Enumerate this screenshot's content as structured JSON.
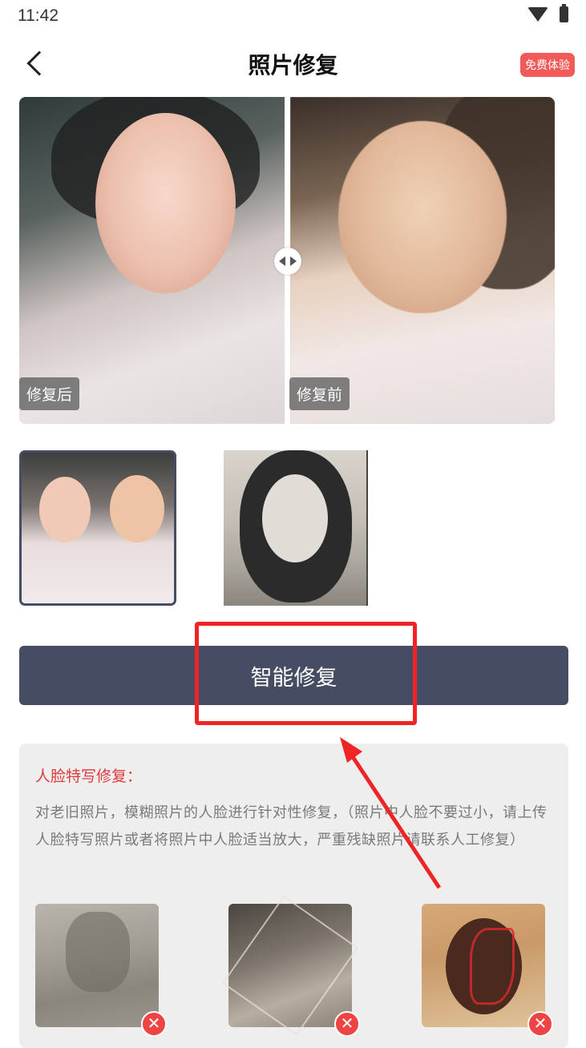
{
  "status": {
    "time": "11:42"
  },
  "header": {
    "title": "照片修复",
    "free_badge": "免费体验"
  },
  "compare": {
    "after_label": "修复后",
    "before_label": "修复前"
  },
  "main_button": {
    "label": "智能修复"
  },
  "info": {
    "heading": "人脸特写修复：",
    "description": "对老旧照片，模糊照片的人脸进行针对性修复，（照片中人脸不要过小，请上传人脸特写照片或者将照片中人脸适当放大，严重残缺照片请联系人工修复）"
  },
  "colors": {
    "primary": "#464c62",
    "accent_red": "#ef2525",
    "badge_red": "#f25a5a",
    "heading_red": "#e03b3b"
  }
}
